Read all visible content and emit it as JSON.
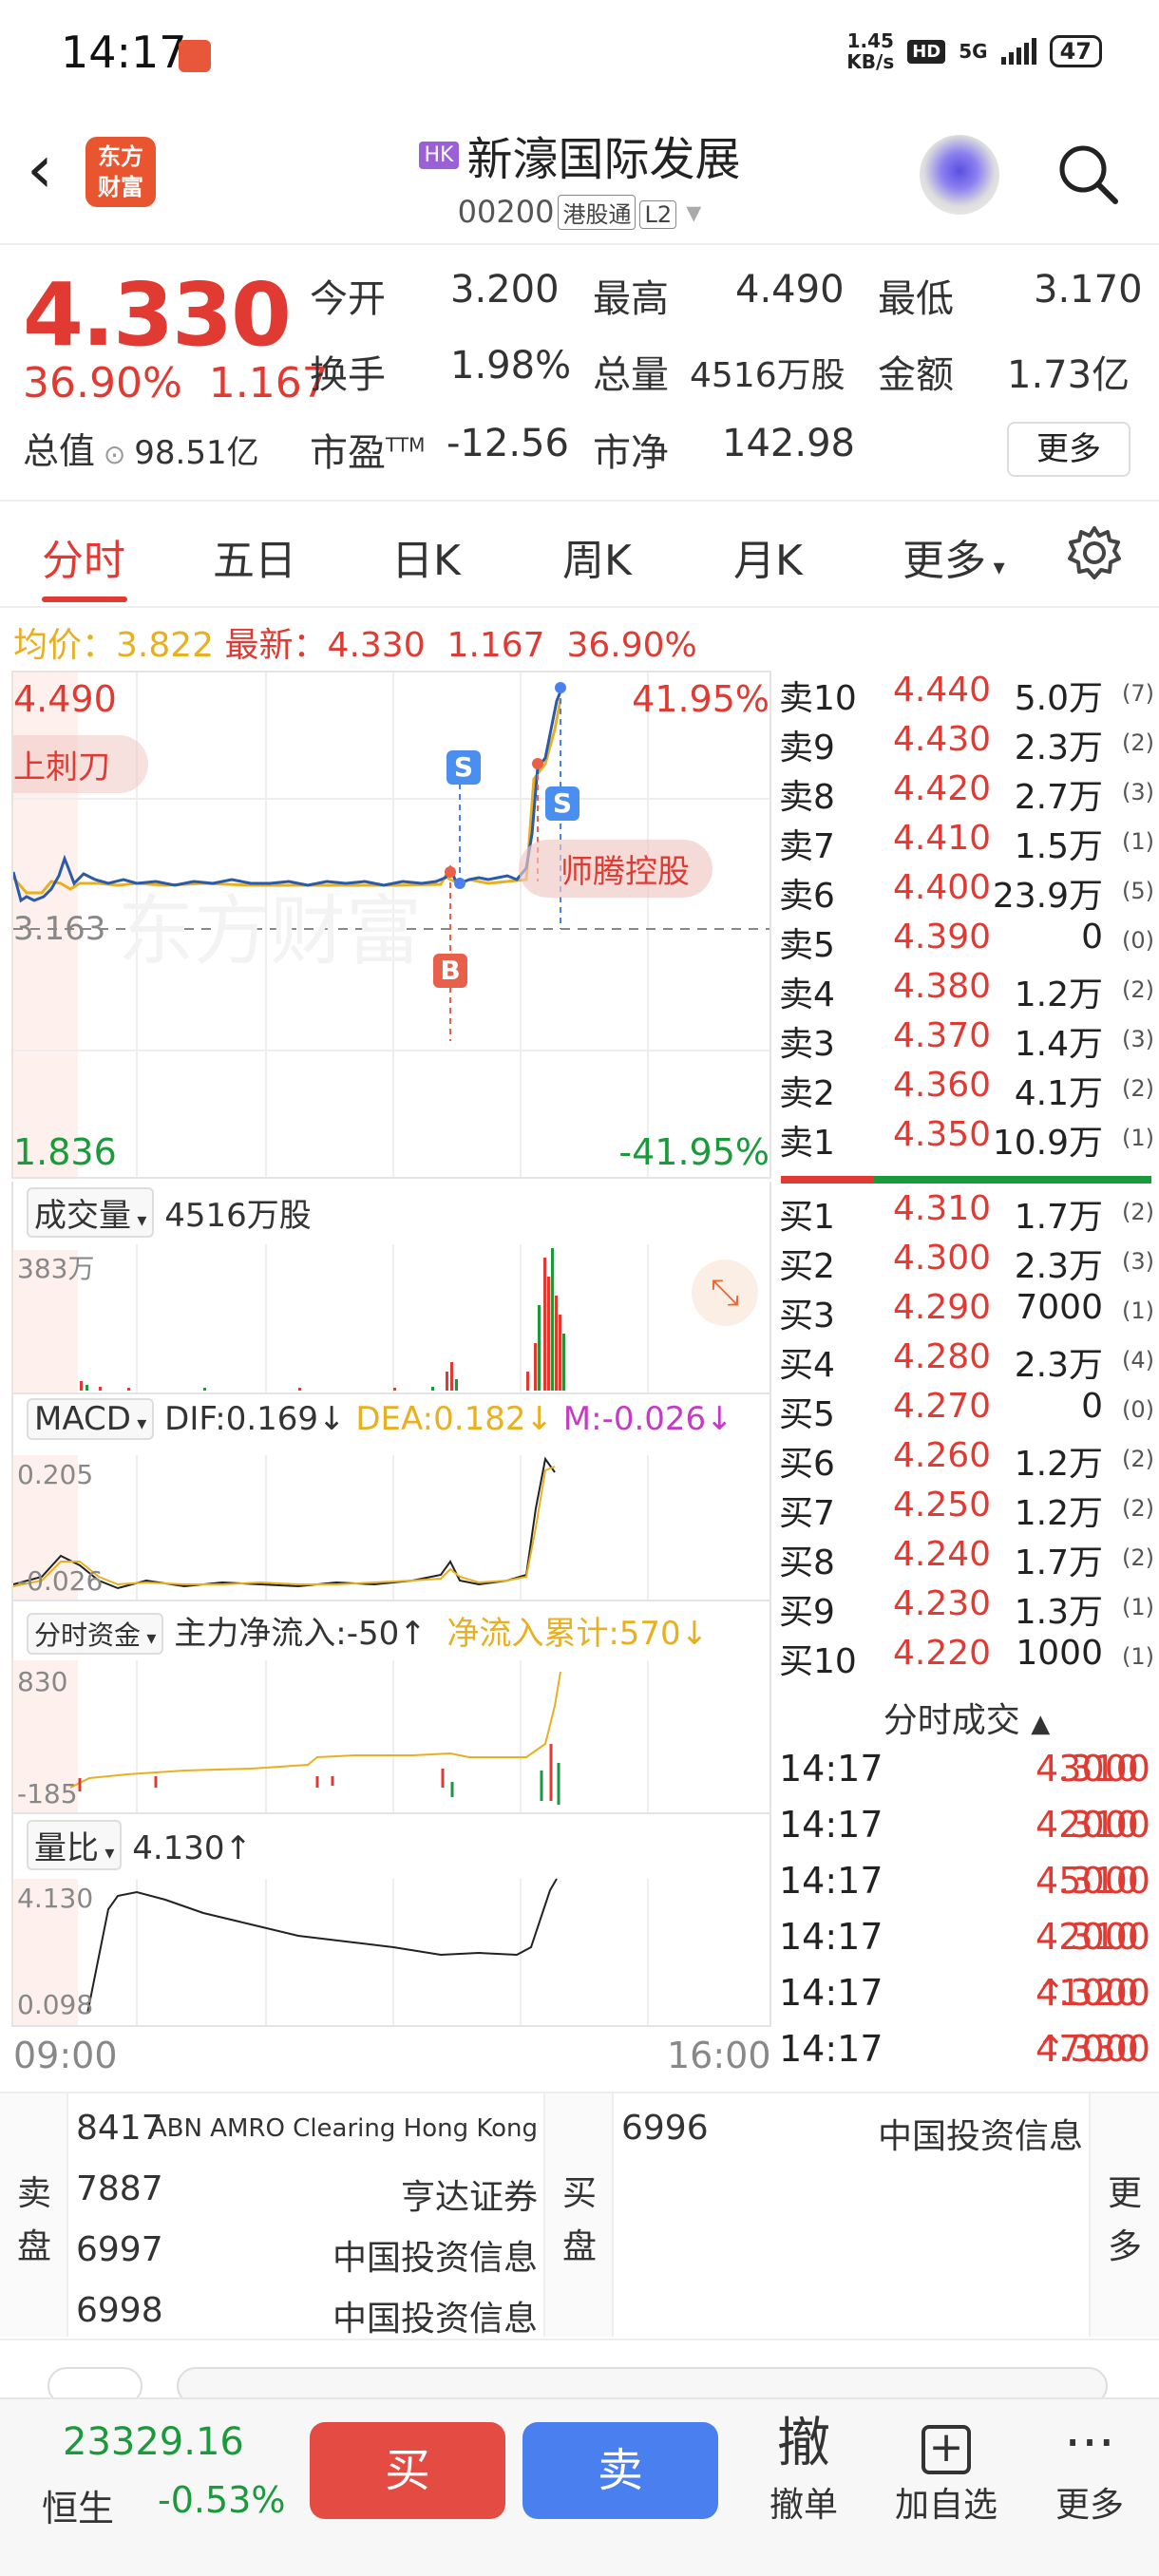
{
  "status_bar": {
    "time": "14:17",
    "speed_top": "1.45",
    "speed_bottom": "KB/s",
    "hd": "HD",
    "net": "5G",
    "battery": "47"
  },
  "header": {
    "back_glyph": "‹",
    "logo_line1": "东方",
    "logo_line2": "财富",
    "market_tag": "HK",
    "title": "新濠国际发展",
    "code": "00200",
    "tag1": "港股通",
    "tag2": "L2",
    "dropdown": "▾"
  },
  "quote": {
    "price": "4.330",
    "change_pct": "36.90%",
    "change": "1.167",
    "open_label": "今开",
    "open": "3.200",
    "high_label": "最高",
    "high": "4.490",
    "low_label": "最低",
    "low": "3.170",
    "turnover_label": "换手",
    "turnover": "1.98%",
    "volume_label": "总量",
    "volume": "4516万股",
    "amount_label": "金额",
    "amount": "1.73亿",
    "mcap_label": "总值",
    "mcap": "98.51亿",
    "pe_label": "市盈",
    "pe_sup": "TTM",
    "pe": "-12.56",
    "pb_label": "市净",
    "pb": "142.98",
    "more": "更多"
  },
  "tabs": [
    "分时",
    "五日",
    "日K",
    "周K",
    "月K",
    "更多"
  ],
  "avg_line": {
    "avg_label": "均价：",
    "avg": "3.822",
    "latest_label": "最新：",
    "latest": "4.330",
    "change": "1.167",
    "pct": "36.90%"
  },
  "chart": {
    "high": "4.490",
    "high_pct": "41.95%",
    "low": "1.836",
    "low_pct": "-41.95%",
    "prev_close": "3.163",
    "tag_left": "上刺刀",
    "tag_right": "师腾控股",
    "watermark": "东方财富",
    "marker_s": "S",
    "marker_b": "B",
    "time_start": "09:00",
    "time_end": "16:00"
  },
  "order_book": {
    "asks": [
      {
        "l": "卖10",
        "p": "4.440",
        "v": "5.0万",
        "n": "(7)"
      },
      {
        "l": "卖9",
        "p": "4.430",
        "v": "2.3万",
        "n": "(2)"
      },
      {
        "l": "卖8",
        "p": "4.420",
        "v": "2.7万",
        "n": "(3)"
      },
      {
        "l": "卖7",
        "p": "4.410",
        "v": "1.5万",
        "n": "(1)"
      },
      {
        "l": "卖6",
        "p": "4.400",
        "v": "23.9万",
        "n": "(5)"
      },
      {
        "l": "卖5",
        "p": "4.390",
        "v": "0",
        "n": "(0)"
      },
      {
        "l": "卖4",
        "p": "4.380",
        "v": "1.2万",
        "n": "(2)"
      },
      {
        "l": "卖3",
        "p": "4.370",
        "v": "1.4万",
        "n": "(3)"
      },
      {
        "l": "卖2",
        "p": "4.360",
        "v": "4.1万",
        "n": "(2)"
      },
      {
        "l": "卖1",
        "p": "4.350",
        "v": "10.9万",
        "n": "(1)"
      }
    ],
    "bids": [
      {
        "l": "买1",
        "p": "4.310",
        "v": "1.7万",
        "n": "(2)"
      },
      {
        "l": "买2",
        "p": "4.300",
        "v": "2.3万",
        "n": "(3)"
      },
      {
        "l": "买3",
        "p": "4.290",
        "v": "7000",
        "n": "(1)"
      },
      {
        "l": "买4",
        "p": "4.280",
        "v": "2.3万",
        "n": "(4)"
      },
      {
        "l": "买5",
        "p": "4.270",
        "v": "0",
        "n": "(0)"
      },
      {
        "l": "买6",
        "p": "4.260",
        "v": "1.2万",
        "n": "(2)"
      },
      {
        "l": "买7",
        "p": "4.250",
        "v": "1.2万",
        "n": "(2)"
      },
      {
        "l": "买8",
        "p": "4.240",
        "v": "1.7万",
        "n": "(2)"
      },
      {
        "l": "买9",
        "p": "4.230",
        "v": "1.3万",
        "n": "(1)"
      },
      {
        "l": "买10",
        "p": "4.220",
        "v": "1000",
        "n": "(1)"
      }
    ]
  },
  "volume_panel": {
    "selector": "成交量",
    "total": "4516万股",
    "max": "383万"
  },
  "macd_panel": {
    "selector": "MACD",
    "dif": "DIF:0.169↓",
    "dea": "DEA:0.182↓",
    "m": "M:-0.026↓",
    "top": "0.205",
    "bottom": "-0.026"
  },
  "fund_panel": {
    "selector": "分时资金",
    "main": "主力净流入:-50↑",
    "cum": "净流入累计:570↓",
    "top": "830",
    "bottom": "-185"
  },
  "ratio_panel": {
    "selector": "量比",
    "value": "4.130↑",
    "top": "4.130",
    "bottom": "0.098"
  },
  "trades": {
    "header": "分时成交",
    "arrow": "▲",
    "rows": [
      {
        "t": "14:17",
        "p": "4.310",
        "v": "3000",
        "dir": ""
      },
      {
        "t": "14:17",
        "p": "4.310",
        "v": "2000",
        "dir": ""
      },
      {
        "t": "14:17",
        "p": "4.310",
        "v": "5000",
        "dir": ""
      },
      {
        "t": "14:17",
        "p": "4.310",
        "v": "2000",
        "dir": ""
      },
      {
        "t": "14:17",
        "p": "4.320",
        "v": "1000",
        "dir": "↑"
      },
      {
        "t": "14:17",
        "p": "4.330",
        "v": "7000",
        "dir": "↑"
      }
    ]
  },
  "broker": {
    "sell_label": "卖盘",
    "buy_label": "买盘",
    "more_label": "更多",
    "sell": [
      {
        "id": "8417",
        "name": "ABN AMRO Clearing Hong Kong"
      },
      {
        "id": "7887",
        "name": "亨达证券"
      },
      {
        "id": "6997",
        "name": "中国投资信息"
      },
      {
        "id": "6998",
        "name": "中国投资信息"
      }
    ],
    "buy": [
      {
        "id": "6996",
        "name": "中国投资信息"
      }
    ]
  },
  "bottom_bar": {
    "index_value": "23329.16",
    "index_name": "恒生",
    "index_pct": "-0.53%",
    "buy": "买",
    "sell": "卖",
    "cancel_glyph": "撤",
    "cancel": "撤单",
    "add_glyph": "+",
    "add": "加自选",
    "more_glyph": "···",
    "more": "更多"
  },
  "colors": {
    "up": "#e03a32",
    "down": "#1b9a3c",
    "accent_blue": "#4a7ff0",
    "avg": "#e8b020"
  }
}
